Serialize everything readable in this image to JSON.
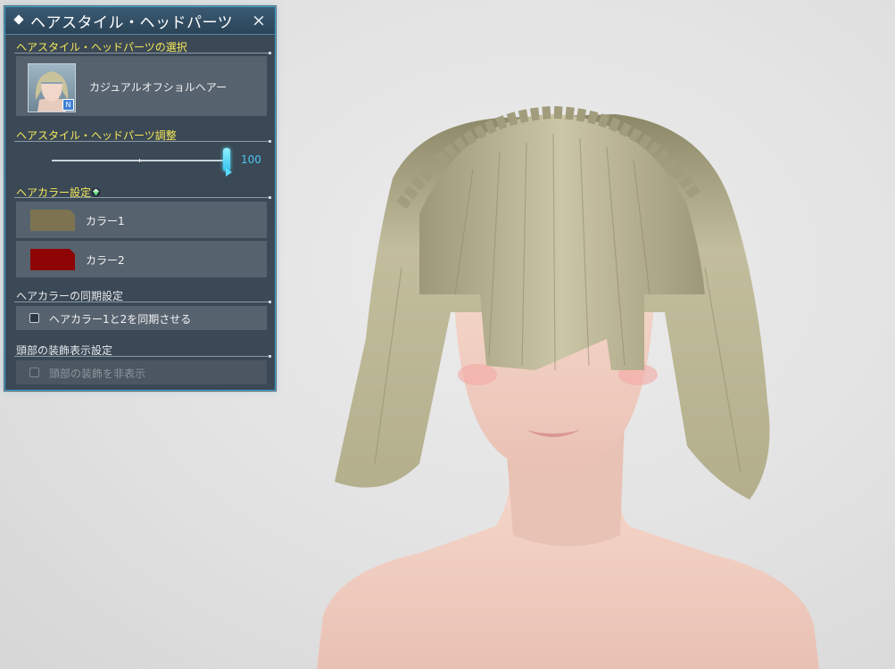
{
  "panel": {
    "title": "ヘアスタイル・ヘッドパーツ",
    "close_icon": "×",
    "hairstyle_section": {
      "label": "ヘアスタイル・ヘッドパーツの選択",
      "selected_name": "カジュアルオフショルヘアー",
      "badge": "N"
    },
    "adjust_section": {
      "label": "ヘアスタイル・ヘッドパーツ調整",
      "value": 100,
      "value_text": "100",
      "max": 100
    },
    "color_section": {
      "label": "ヘアカラー設定",
      "colors": [
        {
          "label": "カラー1",
          "hex": "#7d7351"
        },
        {
          "label": "カラー2",
          "hex": "#8e0303"
        }
      ]
    },
    "sync_section": {
      "label": "ヘアカラーの同期設定",
      "checkbox_label": "ヘアカラー1と2を同期させる",
      "checked": false
    },
    "head_deco_section": {
      "label": "頭部の装飾表示設定",
      "checkbox_label": "頭部の装飾を非表示",
      "checked": false,
      "disabled": true
    }
  },
  "colors": {
    "panel_bg": "#2e3c4a",
    "accent": "#3fa9d6",
    "section_label": "#f5e85a",
    "slider_value": "#4cc6f0"
  }
}
